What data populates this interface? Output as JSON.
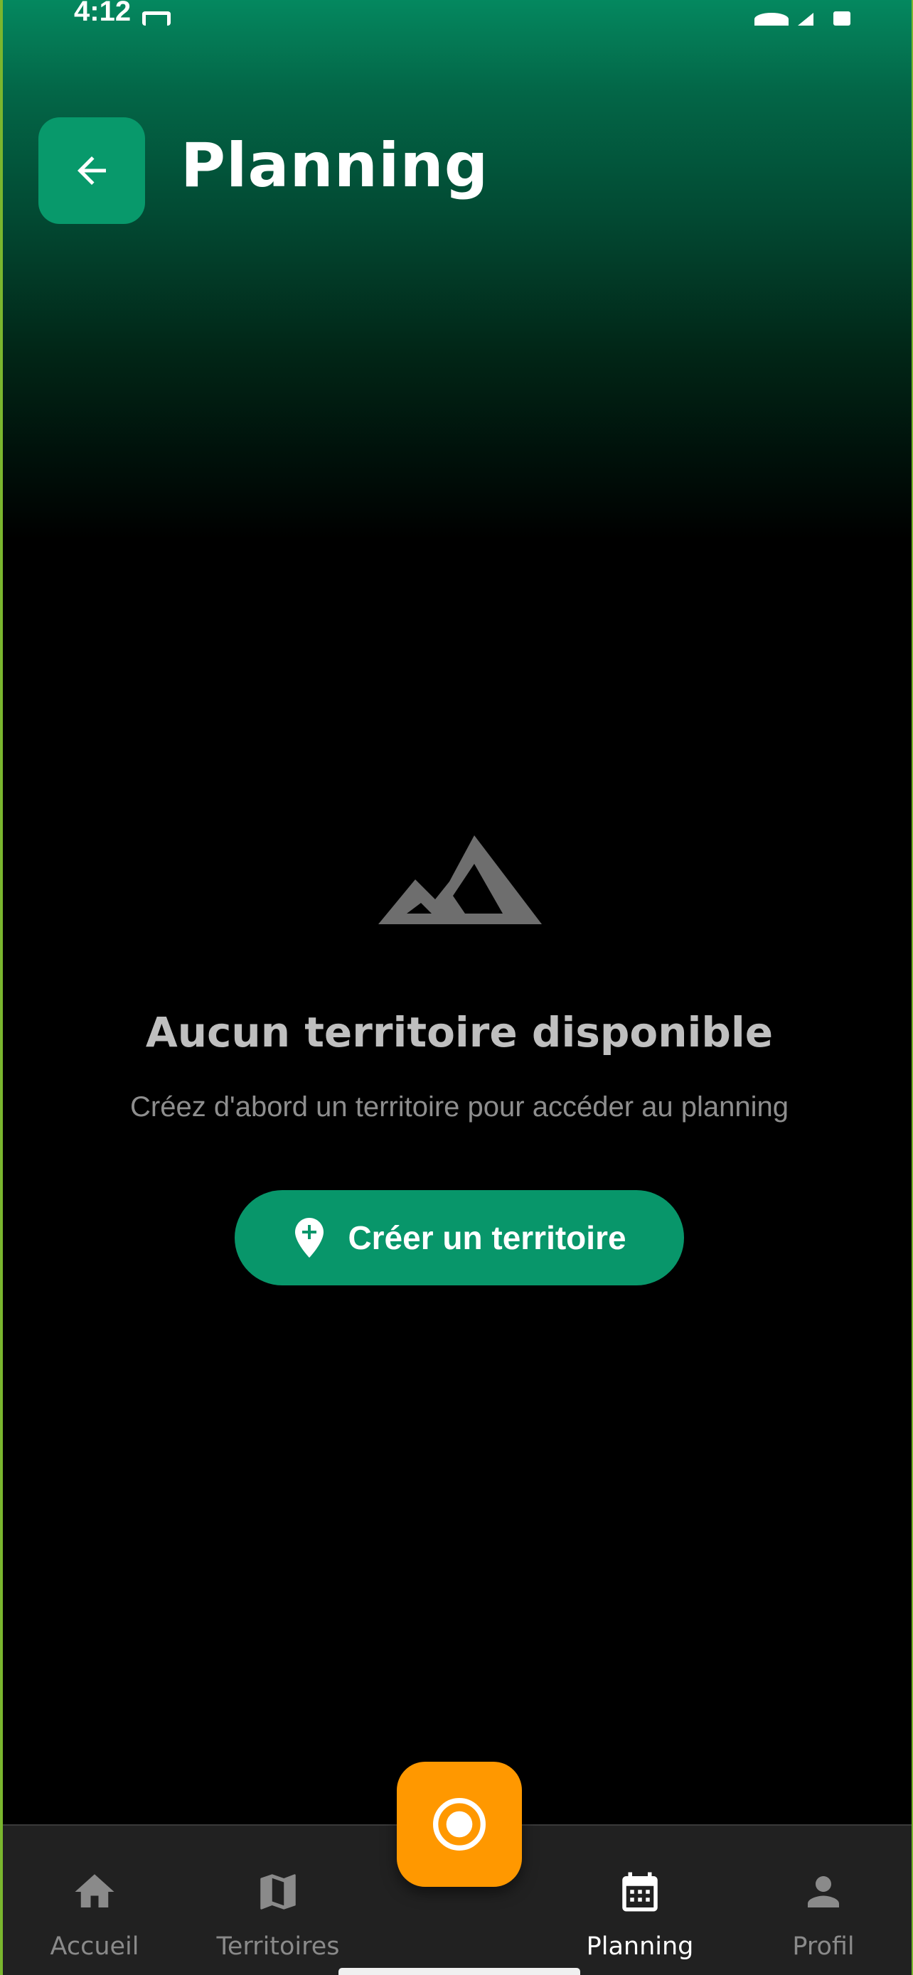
{
  "status_bar": {
    "time": "4:12",
    "icons": [
      "cast-icon",
      "wifi-icon",
      "signal-icon",
      "battery-icon"
    ]
  },
  "header": {
    "title": "Planning",
    "back_icon": "arrow-left-icon"
  },
  "empty_state": {
    "icon": "mountain-icon",
    "title": "Aucun territoire disponible",
    "subtitle": "Créez d'abord un territoire pour accéder au planning",
    "button_label": "Créer un territoire",
    "button_icon": "add-location-icon"
  },
  "fab": {
    "icon": "record-icon"
  },
  "bottom_nav": {
    "items": [
      {
        "label": "Accueil",
        "icon": "home-icon",
        "active": false
      },
      {
        "label": "Territoires",
        "icon": "map-icon",
        "active": false
      },
      {
        "label": "Planning",
        "icon": "calendar-icon",
        "active": true
      },
      {
        "label": "Profil",
        "icon": "person-icon",
        "active": false
      }
    ]
  },
  "colors": {
    "primary_green": "#08996b",
    "fab_orange": "#ff9800",
    "nav_background": "#212121",
    "muted_text": "#8e8e8e"
  }
}
